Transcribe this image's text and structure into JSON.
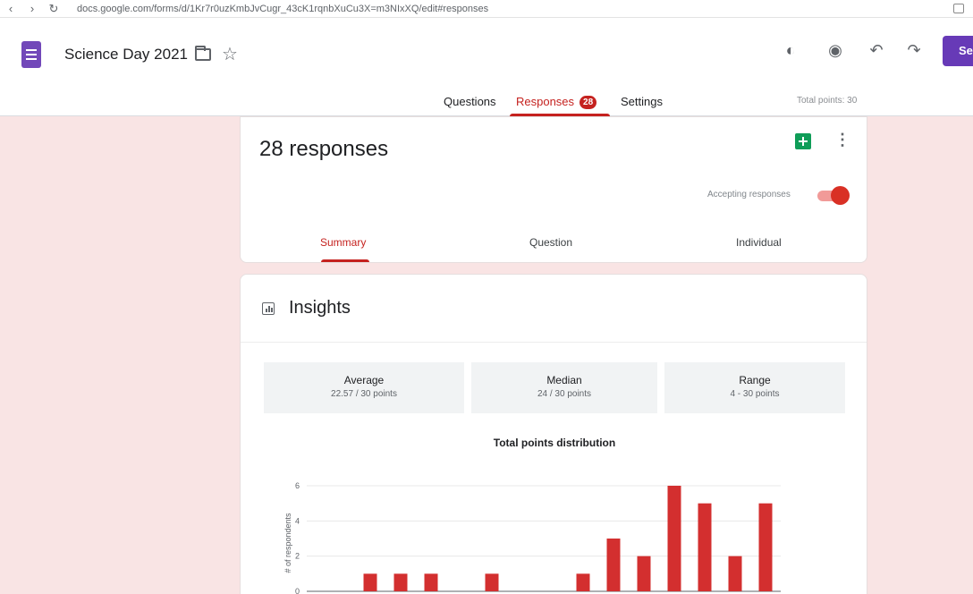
{
  "browser": {
    "url": "docs.google.com/forms/d/1Kr7r0uzKmbJvCugr_43cK1rqnbXuCu3X=m3NIxXQ/edit#responses"
  },
  "header": {
    "doc_title": "Science Day 2021",
    "send_label": "Se",
    "tabs": [
      {
        "label": "Questions"
      },
      {
        "label": "Responses",
        "badge": "28"
      },
      {
        "label": "Settings"
      }
    ],
    "total_points": "Total points: 30"
  },
  "responses": {
    "count_label": "28 responses",
    "accepting_label": "Accepting responses",
    "accepting": true,
    "subtabs": [
      {
        "label": "Summary"
      },
      {
        "label": "Question"
      },
      {
        "label": "Individual"
      }
    ]
  },
  "insights": {
    "title": "Insights",
    "stats": [
      {
        "label": "Average",
        "value": "22.57 / 30 points"
      },
      {
        "label": "Median",
        "value": "24 / 30 points"
      },
      {
        "label": "Range",
        "value": "4 - 30 points"
      }
    ]
  },
  "chart_data": {
    "type": "bar",
    "title": "Total points distribution",
    "ylabel": "# of respondents",
    "yticks": [
      "0",
      "2",
      "4",
      "6"
    ],
    "ylim": [
      0,
      6
    ],
    "grid": true,
    "color": "#d32f2f",
    "values": [
      0,
      1,
      1,
      1,
      0,
      1,
      0,
      0,
      1,
      3,
      2,
      6,
      5,
      2,
      5
    ]
  },
  "colors": {
    "accent": "#c5221f",
    "forms_purple": "#673ab7",
    "background": "#f9e4e4"
  }
}
